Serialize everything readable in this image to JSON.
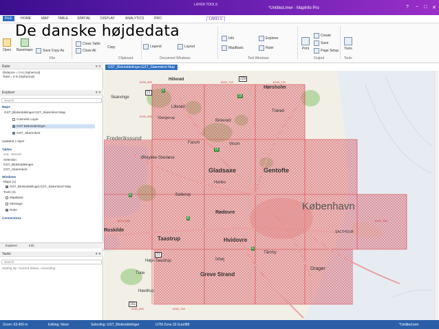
{
  "window": {
    "context_label": "LAYER TOOLS",
    "app_title": "*Untitled.mwr - MapInfo Pro",
    "controls": [
      "?",
      "−",
      "□",
      "✕"
    ]
  },
  "ribbon_tabs": [
    "FILE",
    "HOME",
    "MAP",
    "TABLE",
    "SPATIAL",
    "DISPLAY",
    "ANALYTICS",
    "PRO",
    "LABELS"
  ],
  "overlay_title": "De danske højdedata",
  "ribbon": {
    "file": {
      "open": "Open",
      "basemaps": "Basemaps",
      "save_copy_as": "Save Copy As",
      "group": "File"
    },
    "clipboard": {
      "close_table": "Close Table",
      "close_all": "Close All",
      "copy": "Copy",
      "group": "Clipboard"
    },
    "document_windows": {
      "legend": "Legend",
      "layout": "Layout",
      "group": "Document Windows"
    },
    "tool_windows": {
      "info": "Info",
      "explorer": "Explorer",
      "mapbasic": "MapBasic",
      "ruler": "Ruler",
      "group": "Tool Windows"
    },
    "output": {
      "print": "Print",
      "create": "Create",
      "save": "Save",
      "page_setup": "Page Setup",
      "group": "Output"
    },
    "tools": {
      "tools": "Tools",
      "group": "Tools"
    }
  },
  "ruler": {
    "title": "Ruler",
    "distance": "Distance  = 0 m (Spherical)",
    "total": "Total       = 0 m (Spherical)"
  },
  "explorer": {
    "title": "Explorer",
    "search_placeholder": "Search",
    "maps_header": "Maps",
    "map_item": "GST_Blokinddelinger,GST_Skærmkort Map",
    "layers": [
      "Cosmetic Layer",
      "GST Blokinddelinger",
      "GST_Skærmkort"
    ],
    "updated": "Updated 1 layer",
    "tables_header": "Tables",
    "tables_sort": "Got.: Recent",
    "tables": [
      "Selection",
      "GST_Blokinddelinger",
      "GST_Skærmkort"
    ],
    "windows_header": "Windows",
    "maps_count": "Maps (1)",
    "window_map": "GST_Blokinddelinger,GST_Skærmkort Map",
    "tools_count": "Tools (3)",
    "tools": [
      "MapBasic",
      "Message",
      "Ruler"
    ],
    "connections": "Connections",
    "tab_explorer": "Explorer",
    "tab_info": "Info"
  },
  "tasks": {
    "title": "Tasks",
    "search_placeholder": "Search",
    "sorting": "Sorting By: Current Status, Ascending"
  },
  "map_tab": "GST_Blokinddelinger,GST_Skærmkort Map",
  "map_labels": {
    "towns_large": [
      "Gladsaxe",
      "Gentofte",
      "København",
      "Taastrup",
      "Hvidovre",
      "Greve Strand"
    ],
    "towns_small": [
      "Hillerød",
      "Hørsholm",
      "Skævinge",
      "Lillerød",
      "Slangerup",
      "Birkerød",
      "Trørød",
      "Frederikssund",
      "Farum",
      "Virum",
      "Ølstykke-Stenløse",
      "Herlev",
      "Ballerup",
      "Rødovre",
      "Høje-Taastrup",
      "Ishøj",
      "Tårnby",
      "Dragør",
      "Roskilde",
      "Tune",
      "Havdrup",
      "SALTHOLM"
    ],
    "grid": [
      "6200_690",
      "6200_710",
      "6200_720",
      "6190_690",
      "6170_690",
      "6170_740",
      "6150_700",
      "6150_690"
    ],
    "routes": [
      "229",
      "6",
      "6",
      "21",
      "16",
      "19",
      "6",
      "6",
      "21",
      "151"
    ]
  },
  "status": {
    "zoom": "Zoom: 63.400 m",
    "editing": "Editing: None",
    "selecting": "Selecting: GST_Blokinddelinger",
    "projection": "UTM Zone 32 Euref89",
    "workspace": "*Untitled.wor"
  },
  "colors": {
    "title_bar_start": "#3a0f8e",
    "title_bar_end": "#9a2fc8",
    "accent": "#2d6fc0",
    "grid_line": "#d93a3a",
    "overlay_fill": "#e6717a"
  }
}
